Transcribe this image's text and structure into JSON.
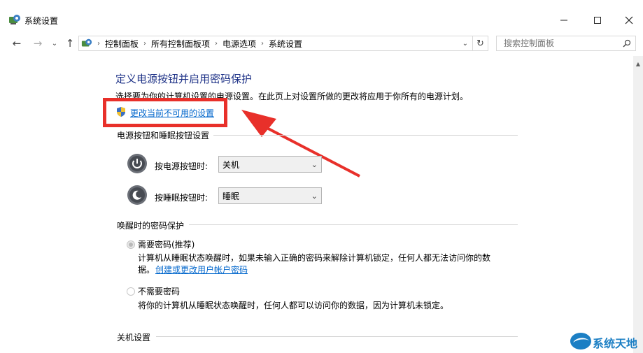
{
  "window": {
    "title": "系统设置"
  },
  "nav": {
    "breadcrumb": [
      "控制面板",
      "所有控制面板项",
      "电源选项",
      "系统设置"
    ],
    "search_placeholder": "搜索控制面板"
  },
  "content": {
    "title": "定义电源按钮并启用密码保护",
    "description": "选择要为你的计算机设置的电源设置。在此页上对设置所做的更改将应用于你所有的电源计划。",
    "change_link": "更改当前不可用的设置",
    "power_section": {
      "header": "电源按钮和睡眠按钮设置",
      "power_button_label": "按电源按钮时:",
      "power_button_value": "关机",
      "sleep_button_label": "按睡眠按钮时:",
      "sleep_button_value": "睡眠"
    },
    "password_section": {
      "header": "唤醒时的密码保护",
      "require_label": "需要密码(推荐)",
      "require_desc_1": "计算机从睡眠状态唤醒时，如果未输入正确的密码来解除计算机锁定，任何人都无法访问你的数",
      "require_desc_2": "据。",
      "require_link": "创建或更改用户帐户密码",
      "norequire_label": "不需要密码",
      "norequire_desc": "将你的计算机从睡眠状态唤醒时，任何人都可以访问你的数据，因为计算机未锁定。"
    },
    "shutdown_section": {
      "header": "关机设置"
    }
  },
  "watermark": {
    "text": "系统天地"
  },
  "colors": {
    "title_blue": "#1e3287",
    "link_blue": "#0066cc",
    "highlight_red": "#e8302a"
  }
}
